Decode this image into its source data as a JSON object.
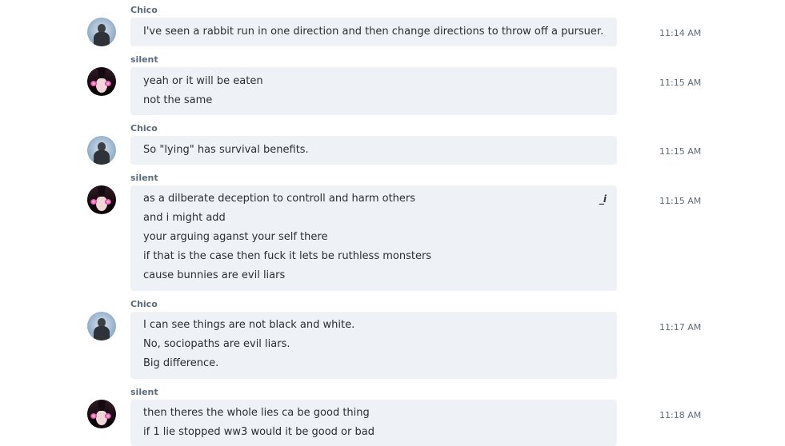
{
  "messages": [
    {
      "sender": "Chico",
      "avatar": "chico-avatar",
      "time": "11:14 AM",
      "lines": [
        "I've seen a rabbit run in one direction and then change directions to throw off a pursuer."
      ]
    },
    {
      "sender": "silent",
      "avatar": "silent-avatar",
      "time": "11:15 AM",
      "lines": [
        "yeah or it will be eaten",
        "not the same"
      ]
    },
    {
      "sender": "Chico",
      "avatar": "chico-avatar",
      "time": "11:15 AM",
      "lines": [
        "So \"lying\" has survival benefits."
      ]
    },
    {
      "sender": "silent",
      "avatar": "silent-avatar",
      "time": "11:15 AM",
      "edit_icon": "_i",
      "lines": [
        "as a dilberate  deception to controll and harm others",
        "and i might add",
        "your arguing aganst your self there",
        "if that is the case then fuck it lets be ruthless monsters",
        "cause bunnies are evil liars"
      ]
    },
    {
      "sender": "Chico",
      "avatar": "chico-avatar",
      "time": "11:17 AM",
      "lines": [
        "I can see things are not black and white.",
        "No, sociopaths are evil liars.",
        "Big difference."
      ]
    },
    {
      "sender": "silent",
      "avatar": "silent-avatar",
      "time": "11:18 AM",
      "lines": [
        "then theres the whole lies ca be good thing",
        "if 1 lie stopped ww3  would it be good or bad"
      ]
    }
  ]
}
